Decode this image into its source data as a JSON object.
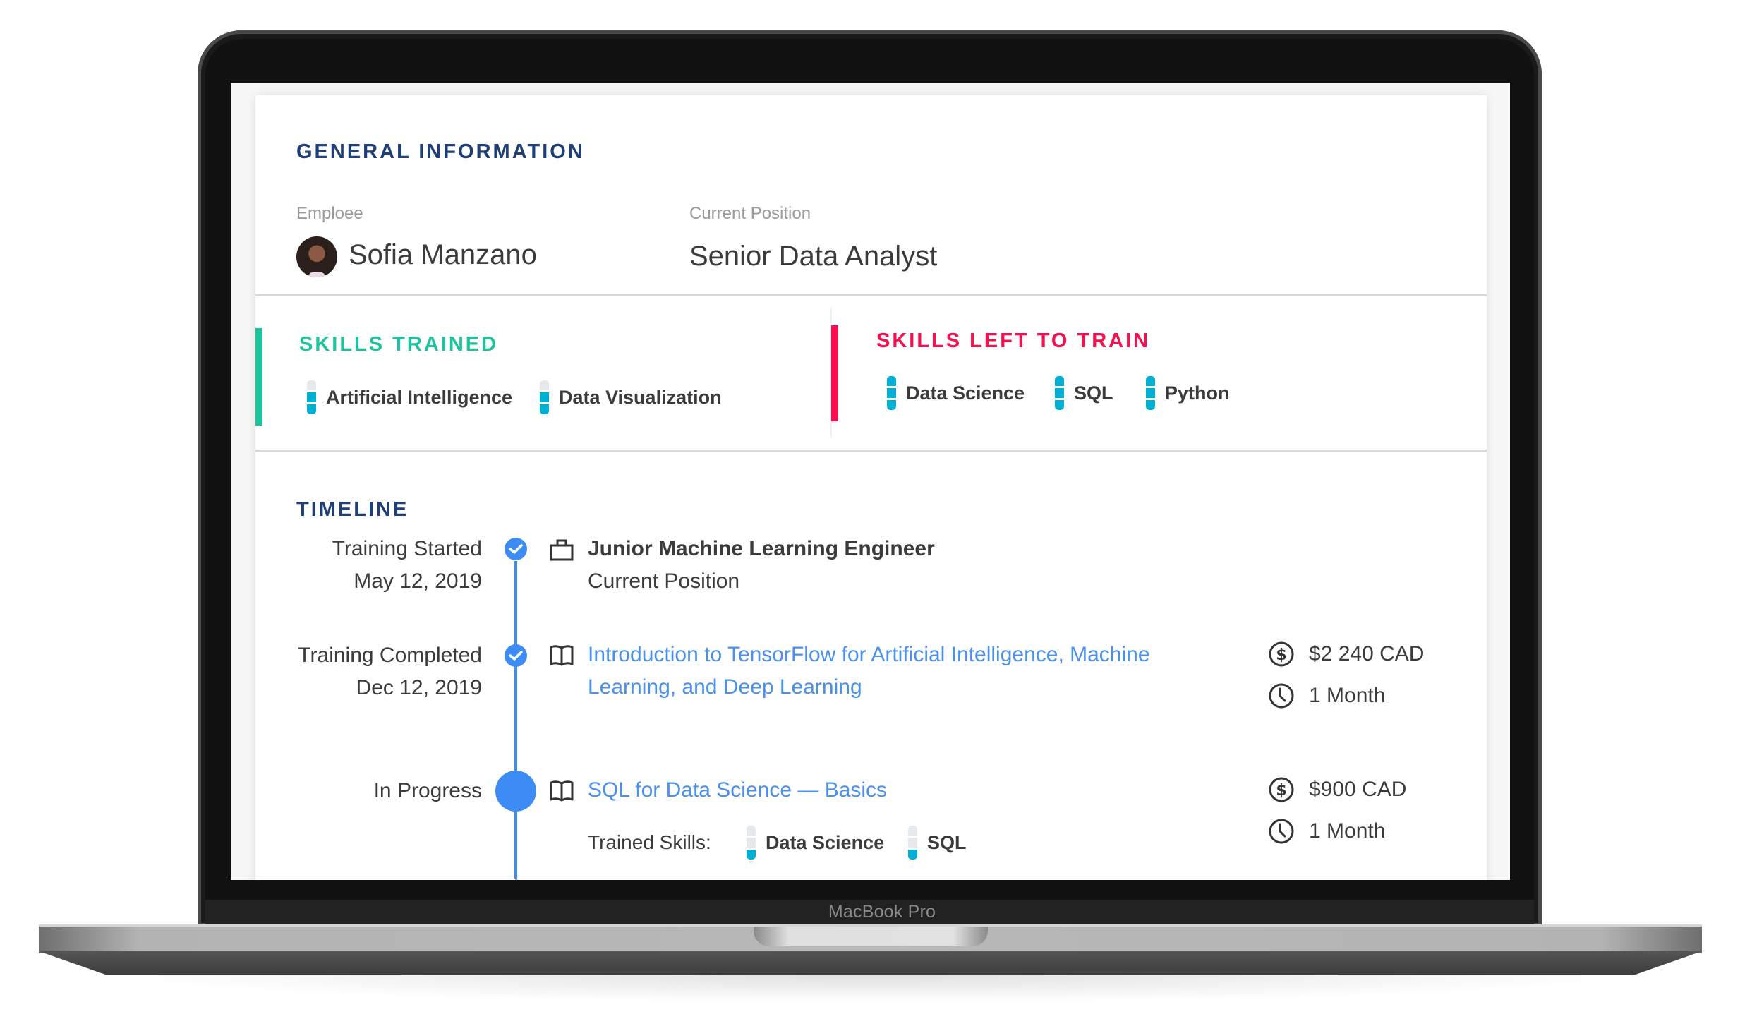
{
  "device": {
    "brand_label": "MacBook Pro"
  },
  "general": {
    "title": "GENERAL INFORMATION",
    "employee_label": "Emploee",
    "employee_name": "Sofia Manzano",
    "position_label": "Current Position",
    "position_value": "Senior Data Analyst"
  },
  "skills_trained": {
    "title": "SKILLS TRAINED",
    "accent_color": "#1dc49b",
    "items": [
      {
        "label": "Artificial Intelligence",
        "level": "2/3"
      },
      {
        "label": "Data Visualization",
        "level": "2/3"
      }
    ]
  },
  "skills_left": {
    "title": "SKILLS LEFT TO TRAIN",
    "accent_color": "#f5104f",
    "items": [
      {
        "label": "Data Science",
        "level": "3/3"
      },
      {
        "label": "SQL",
        "level": "3/3"
      },
      {
        "label": "Python",
        "level": "3/3"
      }
    ]
  },
  "timeline": {
    "title": "TIMELINE",
    "accent_color": "#3d8cf5",
    "events": [
      {
        "status": "Training Started",
        "date": "May 12, 2019",
        "icon": "briefcase-icon",
        "title": "Junior Machine Learning Engineer",
        "subtitle": "Current Position"
      },
      {
        "status": "Training Completed",
        "date": "Dec 12, 2019",
        "icon": "book-icon",
        "course": "Introduction to TensorFlow for Artificial Intelligence, Machine Learning, and Deep Learning",
        "cost": "$2 240 CAD",
        "duration": "1 Month"
      },
      {
        "status": "In Progress",
        "icon": "book-icon",
        "course": "SQL for Data Science — Basics",
        "cost": "$900 CAD",
        "duration": "1 Month",
        "trained_skills_label": "Trained Skills:",
        "trained_skills": [
          {
            "label": "Data Science",
            "level": "1/3"
          },
          {
            "label": "SQL",
            "level": "1/3"
          }
        ]
      }
    ]
  }
}
